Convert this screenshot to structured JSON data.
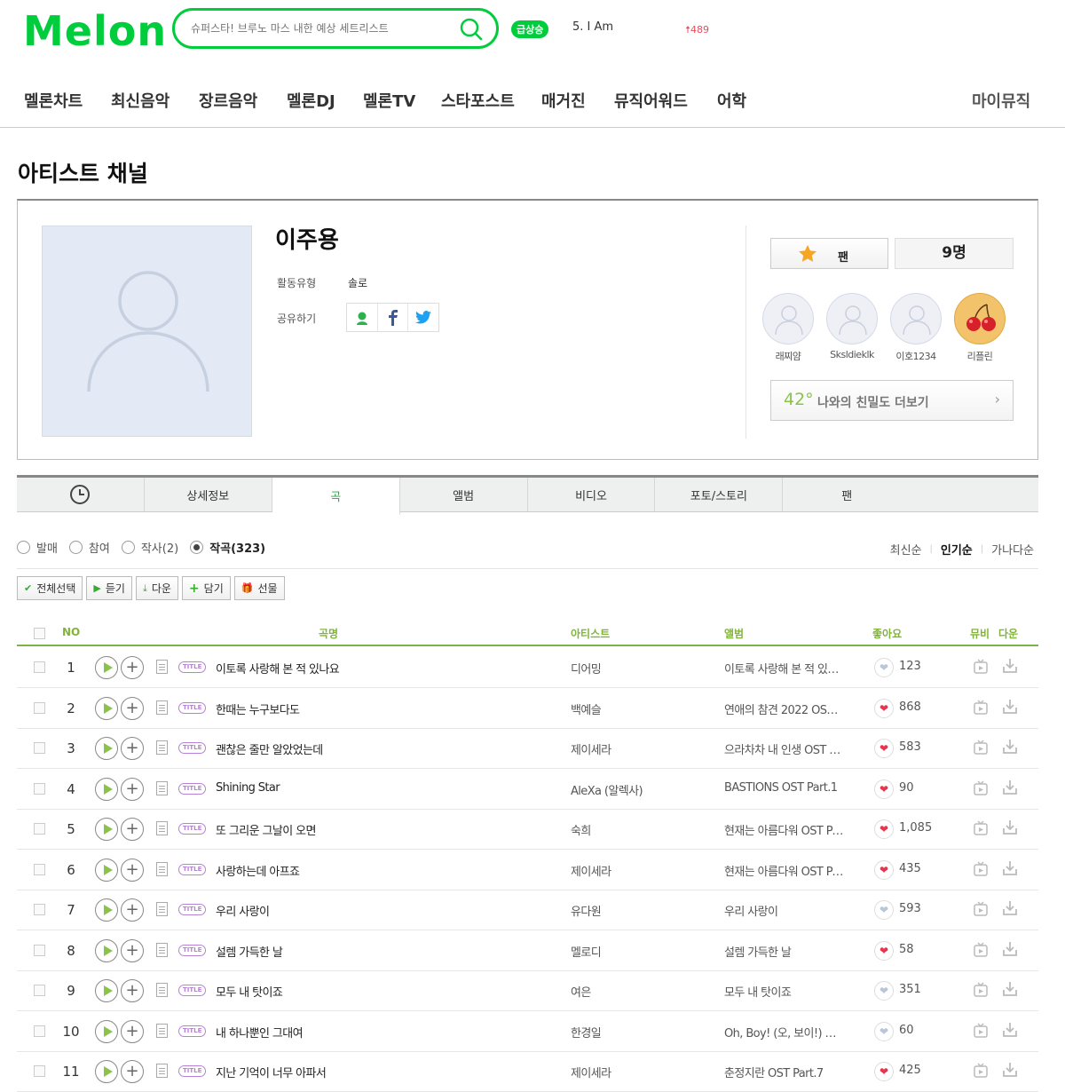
{
  "header": {
    "logo": "Melon",
    "search_placeholder": "슈퍼스타! 브루노 마스 내한 예상 세트리스트",
    "rise_badge": "급상승",
    "chart_rank": "5.  I Am",
    "chart_change": "489"
  },
  "gnb": [
    "멜론차트",
    "최신음악",
    "장르음악",
    "멜론DJ",
    "멜론TV",
    "스타포스트",
    "매거진",
    "뮤직어워드",
    "어학"
  ],
  "gnb_my": "마이뮤직",
  "page_title": "아티스트 채널",
  "artist": {
    "name": "이주용",
    "type_label": "활동유형",
    "type_value": "솔로",
    "share_label": "공유하기"
  },
  "fan": {
    "button": "팬",
    "count": "9명",
    "fans": [
      {
        "name": "래찌얌",
        "icon": "default-avatar-icon"
      },
      {
        "name": "Sksldieklk",
        "icon": "default-avatar-icon"
      },
      {
        "name": "이호1234",
        "icon": "default-avatar-icon"
      },
      {
        "name": "리플린",
        "icon": "cherry-avatar-icon"
      }
    ],
    "intimacy_degree": "42°",
    "intimacy_text": "나와의 친밀도 더보기"
  },
  "tabs": [
    "상세정보",
    "곡",
    "앨범",
    "비디오",
    "포토/스토리",
    "팬"
  ],
  "filters": [
    {
      "label": "발매",
      "selected": false
    },
    {
      "label": "참여",
      "selected": false
    },
    {
      "label": "작사(2)",
      "selected": false
    },
    {
      "label": "작곡(323)",
      "selected": true
    }
  ],
  "sorts": [
    {
      "label": "최신순",
      "active": false
    },
    {
      "label": "인기순",
      "active": true
    },
    {
      "label": "가나다순",
      "active": false
    }
  ],
  "actions": [
    "전체선택",
    "듣기",
    "다운",
    "담기",
    "선물"
  ],
  "columns": {
    "no": "NO",
    "song": "곡명",
    "artist": "아티스트",
    "album": "앨범",
    "like": "좋아요",
    "mv": "뮤비",
    "down": "다운"
  },
  "title_tag": "TITLE",
  "songs": [
    {
      "no": "1",
      "title": "이토록 사랑해 본 적 있나요",
      "artist": "디어밍",
      "album": "이토록 사랑해 본 적 있나요",
      "likes": "123",
      "liked": false
    },
    {
      "no": "2",
      "title": "한때는 누구보다도",
      "artist": "백예슬",
      "album": "연애의 참견 2022 OST - …",
      "likes": "868",
      "liked": true
    },
    {
      "no": "3",
      "title": "괜찮은 줄만 알았었는데",
      "artist": "제이세라",
      "album": "으라차차 내 인생 OST Par…",
      "likes": "583",
      "liked": true
    },
    {
      "no": "4",
      "title": "Shining Star",
      "artist": "AleXa (알렉사)",
      "album": "BASTIONS OST Part.1",
      "likes": "90",
      "liked": true
    },
    {
      "no": "5",
      "title": "또 그리운 그날이 오면",
      "artist": "숙희",
      "album": "현재는 아름다워 OST Part.7",
      "likes": "1,085",
      "liked": true
    },
    {
      "no": "6",
      "title": "사랑하는데 아프죠",
      "artist": "제이세라",
      "album": "현재는 아름다워 OST Part…",
      "likes": "435",
      "liked": true
    },
    {
      "no": "7",
      "title": "우리 사랑이",
      "artist": "유다원",
      "album": "우리 사랑이",
      "likes": "593",
      "liked": false
    },
    {
      "no": "8",
      "title": "설렘 가득한 날",
      "artist": "멜로디",
      "album": "설렘 가득한 날",
      "likes": "58",
      "liked": true
    },
    {
      "no": "9",
      "title": "모두 내 탓이죠",
      "artist": "여은",
      "album": "모두 내 탓이죠",
      "likes": "351",
      "liked": false
    },
    {
      "no": "10",
      "title": "내 하나뿐인 그대여",
      "artist": "한경일",
      "album": "Oh, Boy! (오, 보이!) OST P…",
      "likes": "60",
      "liked": false
    },
    {
      "no": "11",
      "title": "지난 기억이 너무 아파서",
      "artist": "제이세라",
      "album": "춘정지란 OST Part.7",
      "likes": "425",
      "liked": true
    }
  ],
  "colors": {
    "brand": "#00cd3c",
    "accent_green": "#8bc34a",
    "title_tag": "#b681d6",
    "heart": "#e8344e"
  }
}
